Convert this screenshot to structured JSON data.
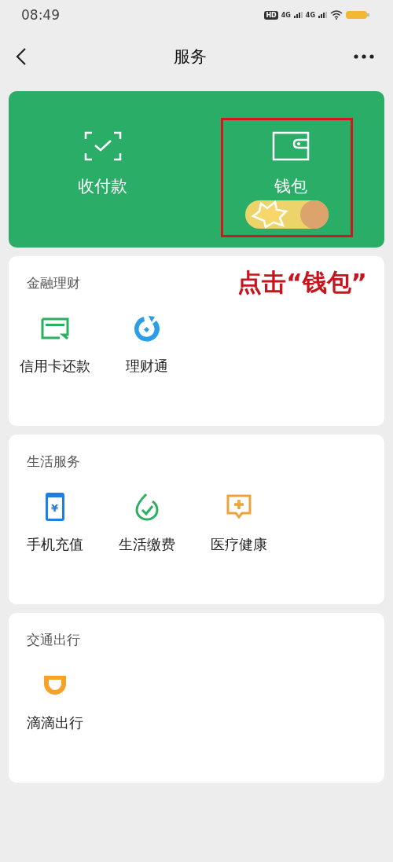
{
  "status_bar": {
    "time": "08:49",
    "hd_label": "HD",
    "networks": [
      "4G",
      "4G"
    ]
  },
  "nav": {
    "title": "服务"
  },
  "top_actions": [
    {
      "kind": "scan",
      "label": "收付款",
      "highlighted": false
    },
    {
      "kind": "wallet",
      "label": "钱包",
      "highlighted": true
    }
  ],
  "annotation": {
    "text": "点击“钱包”"
  },
  "sections": [
    {
      "title": "金融理财",
      "items": [
        {
          "kind": "card",
          "label": "信用卡还款"
        },
        {
          "kind": "fund",
          "label": "理财通"
        }
      ]
    },
    {
      "title": "生活服务",
      "items": [
        {
          "kind": "phone",
          "label": "手机充值",
          "glyph": "¥"
        },
        {
          "kind": "bill",
          "label": "生活缴费"
        },
        {
          "kind": "medical",
          "label": "医疗健康"
        }
      ]
    },
    {
      "title": "交通出行",
      "items": [
        {
          "kind": "ride",
          "label": "滴滴出行"
        }
      ]
    }
  ]
}
